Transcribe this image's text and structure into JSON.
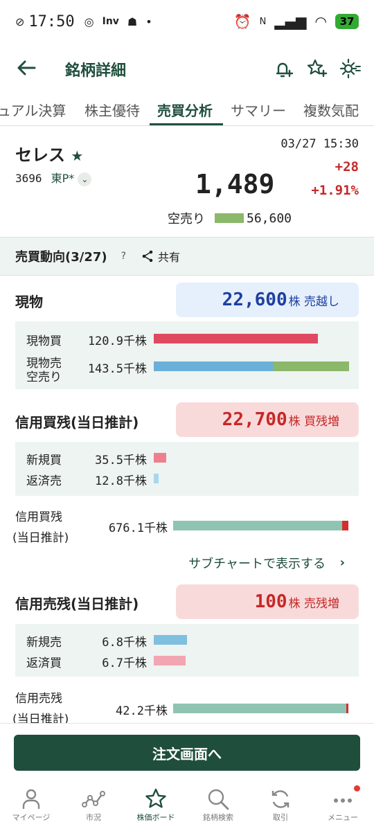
{
  "status_bar": {
    "time": "17:50",
    "battery": "37"
  },
  "header": {
    "title": "銘柄詳細"
  },
  "tabs": [
    {
      "label": "ュアル決算"
    },
    {
      "label": "株主優待"
    },
    {
      "label": "売買分析"
    },
    {
      "label": "サマリー"
    },
    {
      "label": "複数気配"
    }
  ],
  "stock": {
    "name": "セレス",
    "code": "3696",
    "market": "東P*",
    "datetime": "03/27 15:30",
    "price": "1,489",
    "change": "+28",
    "change_pct": "+1.91%",
    "short_label": "空売り",
    "short_value": "56,600"
  },
  "trend": {
    "label": "売買動向(3/27)",
    "help": "?",
    "share": "共有"
  },
  "genbutsu": {
    "title": "現物",
    "value": "22,600",
    "unit": "株 売越し",
    "rows": [
      {
        "label": "現物買",
        "value": "120.9千株",
        "fraction": 0.84
      },
      {
        "label": "現物売",
        "label2": "空売り",
        "value": "143.5千株",
        "fraction": 1.0,
        "short_fraction": 0.39
      }
    ]
  },
  "margin_buy": {
    "title": "信用買残(当日推計)",
    "value": "22,700",
    "unit": "株 買残増",
    "rows": [
      {
        "label": "新規買",
        "value": "35.5千株"
      },
      {
        "label": "返済売",
        "value": "12.8千株"
      }
    ],
    "total_label": "信用買残",
    "total_label2": "(当日推計)",
    "total_value": "676.1千株"
  },
  "subchart_link": "サブチャートで表示する",
  "margin_sell": {
    "title": "信用売残(当日推計)",
    "value": "100",
    "unit": "株 売残増",
    "rows": [
      {
        "label": "新規売",
        "value": "6.8千株"
      },
      {
        "label": "返済買",
        "value": "6.7千株"
      }
    ],
    "total_label": "信用売残",
    "total_label2": "(当日推計)",
    "total_value": "42.2千株"
  },
  "order_button": "注文画面へ",
  "nav": [
    {
      "label": "マイページ",
      "icon": "person-icon"
    },
    {
      "label": "市況",
      "icon": "market-icon"
    },
    {
      "label": "株価ボード",
      "icon": "star-icon"
    },
    {
      "label": "銘柄検索",
      "icon": "search-icon"
    },
    {
      "label": "取引",
      "icon": "refresh-icon"
    },
    {
      "label": "メニュー",
      "icon": "menu-icon"
    }
  ],
  "colors": {
    "brand": "#1f4e3d",
    "up": "#c62828",
    "buy_bar": "#e04a60",
    "sell_bar": "#6ab0d8",
    "short_bar": "#8bb86a",
    "margin_total": "#8fc4b3"
  }
}
